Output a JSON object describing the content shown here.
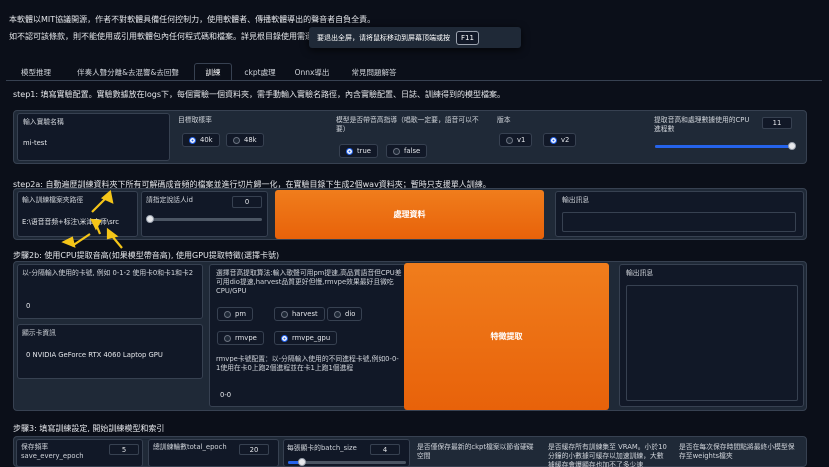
{
  "notice": {
    "line1": "本軟體以MIT協議開源，作者不對軟體具備任何控制力，使用軟體者、傳播軟體導出的聲音者自負全責。",
    "line2_a": "如不認可該條款，則不能使用或引用軟體包內任何程式碼和檔案。詳見根目錄",
    "line2_b": "使用需遵守的協議-LICENSE.txt"
  },
  "toast": {
    "text": "要退出全屏，请将鼠标移动到屏幕顶端或按",
    "key": "F11"
  },
  "tabs": [
    "模型推理",
    "伴奏人聲分離&去混響&去回聲",
    "訓練",
    "ckpt處理",
    "Onnx導出",
    "常見問題解答"
  ],
  "step1": {
    "title": "step1: 填寫實驗配置。實驗數據放在logs下，每個實驗一個資料夾，需手動輸入實驗名路徑，內含實驗配置、日誌、訓練得到的模型檔案。",
    "exp_name_label": "輸入實驗名稱",
    "exp_name_value": "mi-test",
    "sr_label": "目標取樣率",
    "sr_options": [
      "40k",
      "48k"
    ],
    "f0_label": "模型是否帶音高指導（唱歌一定要，語音可以不要）",
    "f0_options": [
      "true",
      "false"
    ],
    "version_label": "版本",
    "version_options": [
      "v1",
      "v2"
    ],
    "cpu_label": "提取音高和處理數據使用的CPU進程數",
    "cpu_value": "11"
  },
  "step2a": {
    "title": "step2a: 自動遍歷訓練資料夾下所有可解碼成音頻的檔案並進行切片歸一化，在實驗目錄下生成2個wav資料夾；暫時只支援單人訓練。",
    "folder_label": "輸入訓練檔案夾路徑",
    "folder_value": "E:\\语音音频+标注\\米津玄师\\src",
    "speaker_label": "請指定說話人id",
    "speaker_value": "0",
    "process_button": "處理資料",
    "output_label": "輸出訊息"
  },
  "step2b": {
    "title": "步驟2b: 使用CPU提取音高(如果模型帶音高), 使用GPU提取特徵(選擇卡號)",
    "gpu_label": "以-分隔輸入使用的卡號, 例如 0-1-2 使用卡0和卡1和卡2",
    "gpu_value": "0",
    "gpu_info_label": "顯示卡資訊",
    "gpu_info_value": "0 NVIDIA GeForce RTX 4060 Laptop GPU",
    "f0_method_label": "選擇音高提取算法:輸入歌聲可用pm提速,高品質語音但CPU差可用dio提速,harvest品質更好但慢,rmvpe效果最好且微吃CPU/GPU",
    "f0_methods": [
      "pm",
      "harvest",
      "dio",
      "rmvpe",
      "rmvpe_gpu"
    ],
    "rmvpe_label": "rmvpe卡號配置：以-分隔輸入使用的不同進程卡號,例如0-0-1使用在卡0上跑2個進程並在卡1上跑1個進程",
    "rmvpe_value": "0-0",
    "extract_button": "特徵提取",
    "output_label": "輸出訊息"
  },
  "step3": {
    "title": "步驟3: 填寫訓練設定, 開始訓練模型和索引",
    "save_freq_label": "保存頻率save_every_epoch",
    "save_freq_value": "5",
    "total_epoch_label": "總訓練輪數total_epoch",
    "total_epoch_value": "20",
    "batch_label": "每張顯卡的batch_size",
    "batch_value": "4",
    "latest_label": "是否僅保存最新的ckpt檔案以節省硬碟空間",
    "cache_label": "是否緩存所有訓練集至 VRAM。小於10分鐘的小數據可緩存以加速訓練，大數據緩存會爆顯存也加不了多少速",
    "weights_label": "是否在每次保存時間點將最終小模型保存至weights檔夾"
  }
}
